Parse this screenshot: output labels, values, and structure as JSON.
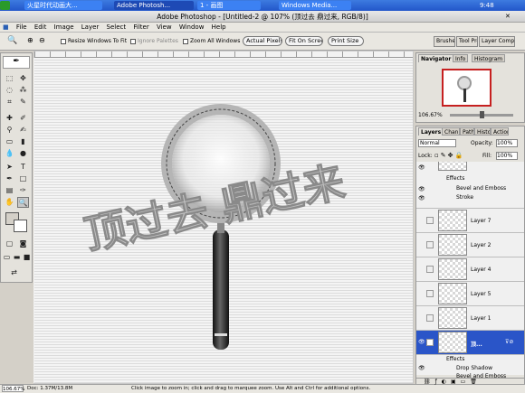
{
  "taskbar": {
    "start_label": "火星时代动画大...",
    "buttons": [
      "Adobe Photosh...",
      "1 - 画图",
      "Windows Media..."
    ],
    "clock": "9:48"
  },
  "window": {
    "title": "Adobe Photoshop - [Untitled-2 @ 107% (顶过去 鼎过来, RGB/8)]"
  },
  "menu": [
    "File",
    "Edit",
    "Image",
    "Layer",
    "Select",
    "Filter",
    "View",
    "Window",
    "Help"
  ],
  "options": {
    "resize_windows": "Resize Windows To Fit",
    "ignore_palettes": "Ignore Palettes",
    "zoom_all": "Zoom All Windows",
    "actual_pixels": "Actual Pixels",
    "fit_on_screen": "Fit On Screen",
    "print_size": "Print Size",
    "panel_tabs": [
      "Brushes",
      "Tool Presets",
      "Layer Comps"
    ]
  },
  "canvas": {
    "watermark": "顶过去 鼎过来",
    "colors": {
      "ring": "#b8b8b8",
      "handle": "#333333"
    }
  },
  "status": {
    "zoom": "106.67%",
    "doc": "Doc: 1.37M/13.8M",
    "hint": "Click image to zoom in; click and drag to marquee zoom. Use Alt and Ctrl for additional options."
  },
  "navigator": {
    "tabs": [
      "Navigator",
      "Info",
      "Histogram"
    ],
    "zoom": "106.67%"
  },
  "layers": {
    "tabs": [
      "Layers",
      "Channels",
      "Paths",
      "History",
      "Actions"
    ],
    "blend_mode": "Normal",
    "opacity_label": "Opacity:",
    "opacity": "100%",
    "lock_label": "Lock:",
    "fill_label": "Fill:",
    "fill": "100%",
    "top_effects": [
      "Effects",
      "Bevel and Emboss",
      "Stroke"
    ],
    "items": [
      "Layer 7",
      "Layer 2",
      "Layer 4",
      "Layer 5",
      "Layer 1"
    ],
    "selected": "顶...",
    "bottom_effects": [
      "Effects",
      "Drop Shadow",
      "Bevel and Emboss"
    ]
  }
}
